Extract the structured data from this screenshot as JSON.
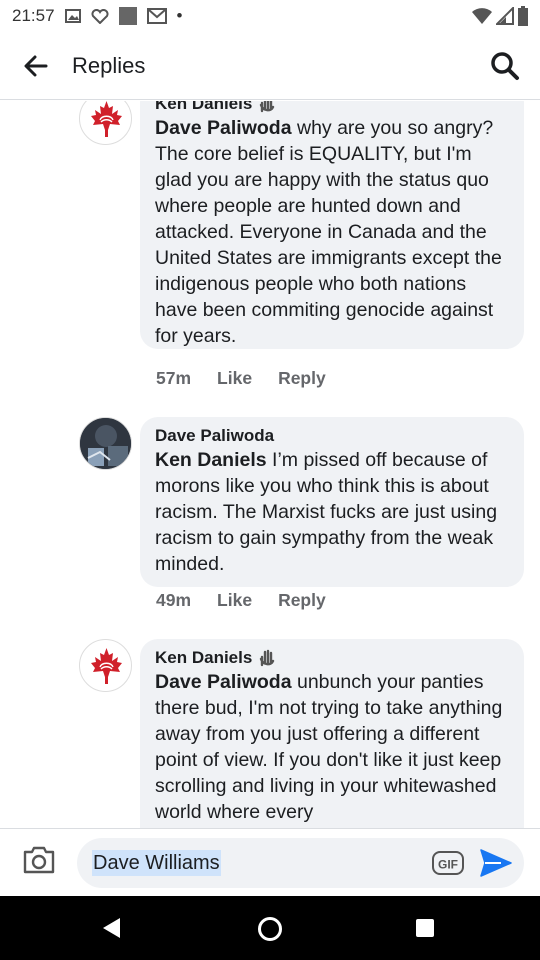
{
  "status_bar": {
    "time": "21:57",
    "dot": "•"
  },
  "header": {
    "title": "Replies"
  },
  "comments": [
    {
      "author": "Ken Daniels",
      "mention": "Dave Paliwoda",
      "text": " why are you so angry? The core belief is EQUALITY, but I'm glad you are happy with the status quo where people are hunted down and attacked. Everyone in Canada and the United States are immigrants except the indigenous people who both nations have been commiting genocide against for years.",
      "time": "57m",
      "like_label": "Like",
      "reply_label": "Reply"
    },
    {
      "author": "Dave Paliwoda",
      "mention": "Ken Daniels",
      "text": " I’m pissed off because of morons like you who think this is about racism. The Marxist fucks are just using racism to gain sympathy from the weak minded.",
      "time": "49m",
      "like_label": "Like",
      "reply_label": "Reply"
    },
    {
      "author": "Ken Daniels",
      "mention": "Dave Paliwoda",
      "text": " unbunch your panties there bud, I'm not trying to take anything away from you just offering a different point of view. If you don't like it just keep scrolling and living in your whitewashed world where every",
      "time": "",
      "like_label": "",
      "reply_label": ""
    }
  ],
  "compose": {
    "value": "Dave Williams",
    "gif_label": "GIF"
  },
  "colors": {
    "accent": "#1877f2",
    "bubble": "#f0f2f5",
    "maple_red": "#d0202a",
    "meta_text": "#65676b"
  }
}
